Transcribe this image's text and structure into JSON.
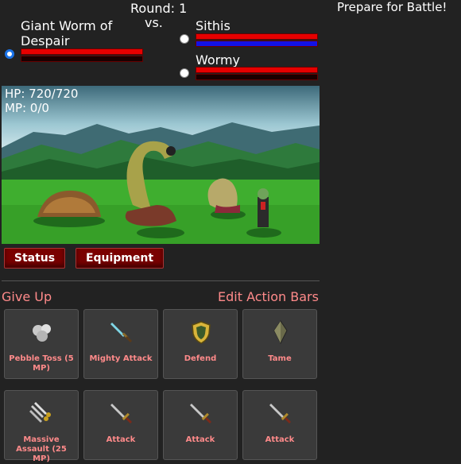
{
  "header": {
    "round": "Round: 1",
    "vs": "vs.",
    "status_message": "Prepare for Battle!"
  },
  "player": {
    "name_line1": "Giant Worm of",
    "name_line2": "Despair",
    "hp_fraction": 1.0,
    "mp_fraction": 0.0
  },
  "enemies": [
    {
      "name": "Sithis",
      "hp_fraction": 1.0,
      "mp_fraction": 1.0,
      "selected": false
    },
    {
      "name": "Wormy",
      "hp_fraction": 1.0,
      "mp_fraction": 0.0,
      "selected": false
    }
  ],
  "scene": {
    "hp": "HP: 720/720",
    "mp": "MP: 0/0"
  },
  "buttons": {
    "status": "Status",
    "equipment": "Equipment"
  },
  "links": {
    "give_up": "Give Up",
    "edit_action_bars": "Edit Action Bars"
  },
  "skills_row1": [
    {
      "label": "Pebble Toss (5 MP)",
      "icon": "pebble-icon"
    },
    {
      "label": "Mighty Attack",
      "icon": "glowing-sword-icon"
    },
    {
      "label": "Defend",
      "icon": "shield-icon"
    },
    {
      "label": "Tame",
      "icon": "crystal-icon"
    }
  ],
  "skills_row2": [
    {
      "label": "Massive Assault (25 MP)",
      "icon": "multi-sword-icon"
    },
    {
      "label": "Attack",
      "icon": "sword-icon"
    },
    {
      "label": "Attack",
      "icon": "sword-icon"
    },
    {
      "label": "Attack",
      "icon": "sword-icon"
    }
  ],
  "colors": {
    "hp_bar": "#e60000",
    "mp_bar_enemy": "#1212e6",
    "link_text": "#ff8a8a",
    "button_bg": "#7a0000"
  }
}
